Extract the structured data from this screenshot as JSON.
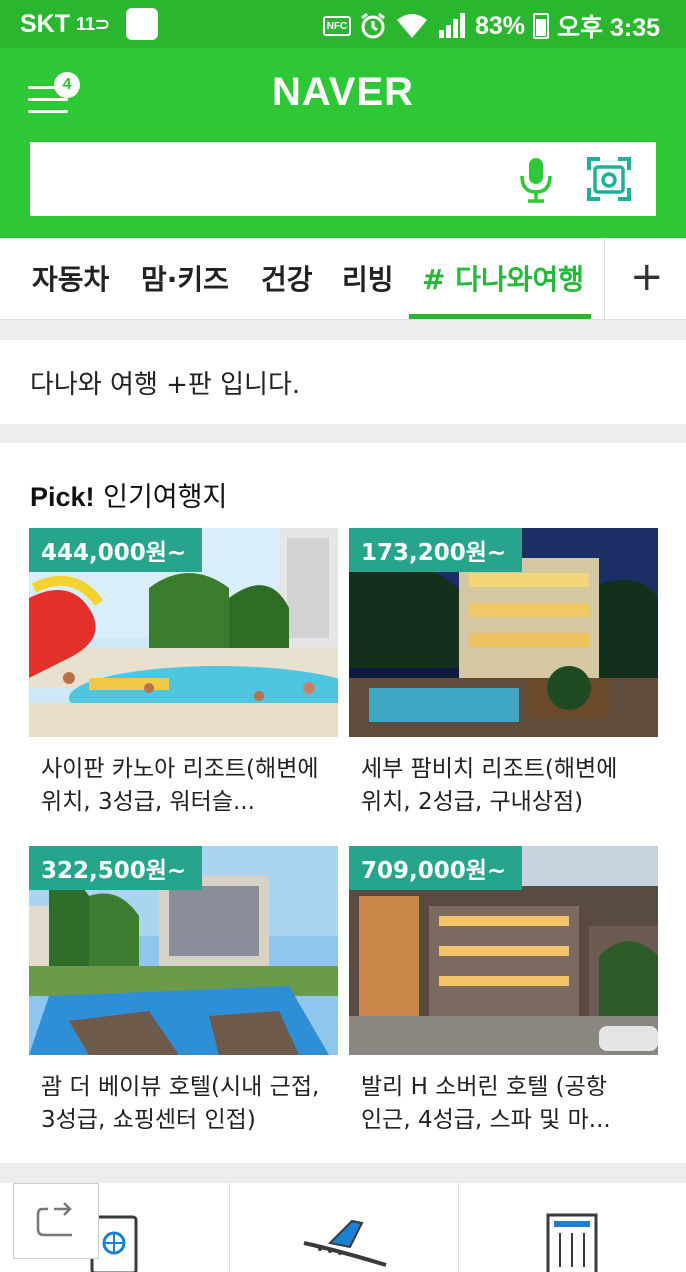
{
  "status_bar": {
    "carrier": "SKT",
    "carrier_extra": "11",
    "battery": "83%",
    "time": "오후 3:35",
    "nfc": "NFC"
  },
  "header": {
    "logo": "NAVER",
    "menu_badge": "4",
    "search": {
      "value": "",
      "placeholder": ""
    }
  },
  "tabs": {
    "items": [
      "자동차",
      "맘·키즈",
      "건강",
      "리빙",
      "# 다나와여행"
    ],
    "active_index": 4,
    "add_label": "+"
  },
  "intro": {
    "text": "다나와 여행 +판 입니다."
  },
  "pick": {
    "title_bold": "Pick!",
    "title_rest": " 인기여행지",
    "cards": [
      {
        "price": "444,000원~",
        "name": "사이판 카노아 리조트(해변에 위치, 3성급, 워터슬..."
      },
      {
        "price": "173,200원~",
        "name": "세부 팜비치 리조트(해변에 위치, 2성급, 구내상점)"
      },
      {
        "price": "322,500원~",
        "name": "괌 더 베이뷰 호텔(시내 근접, 3성급, 쇼핑센터 인접)"
      },
      {
        "price": "709,000원~",
        "name": "발리 H 소버린 호텔 (공항 인근, 4성급, 스파 및 마..."
      }
    ]
  },
  "bottom_nav": {
    "icons": [
      "passport-icon",
      "airplane-icon",
      "hotel-icon"
    ]
  },
  "colors": {
    "naver_green": "#2ec735",
    "status_green": "#2ab72f",
    "price_badge": "#27a58c",
    "active_tab": "#25b83a"
  }
}
